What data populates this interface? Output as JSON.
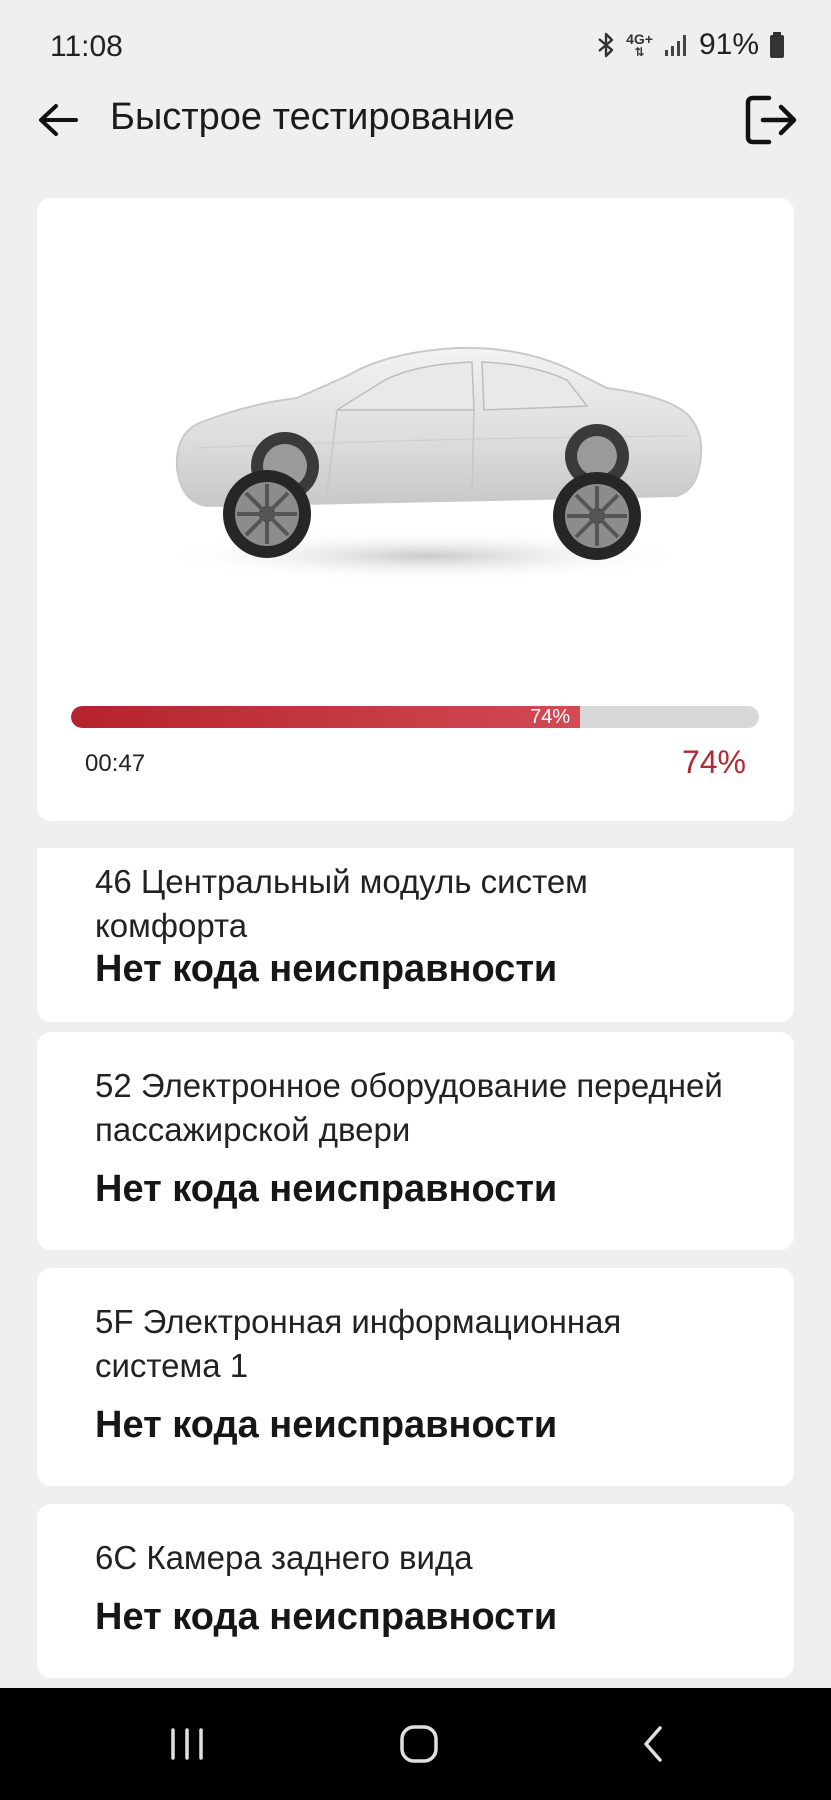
{
  "status_bar": {
    "time": "11:08",
    "network": "4G+",
    "battery": "91%"
  },
  "header": {
    "title": "Быстрое тестирование"
  },
  "progress": {
    "value": 0.74,
    "inner_label": "74%",
    "elapsed": "00:47",
    "percent_label": "74%",
    "color": "#b5232c"
  },
  "results": [
    {
      "name": "46 Центральный модуль систем комфорта",
      "status": "Нет кода неисправности"
    },
    {
      "name": "52 Электронное оборудование передней пассажирской двери",
      "status": "Нет кода неисправности"
    },
    {
      "name": "5F Электронная информационная система 1",
      "status": "Нет кода неисправности"
    },
    {
      "name": "6C Камера заднего вида",
      "status": "Нет кода неисправности"
    }
  ],
  "icons": {
    "back": "arrow-left-icon",
    "exit": "logout-icon",
    "bluetooth": "bluetooth-icon",
    "signal": "signal-icon",
    "battery": "battery-icon"
  }
}
